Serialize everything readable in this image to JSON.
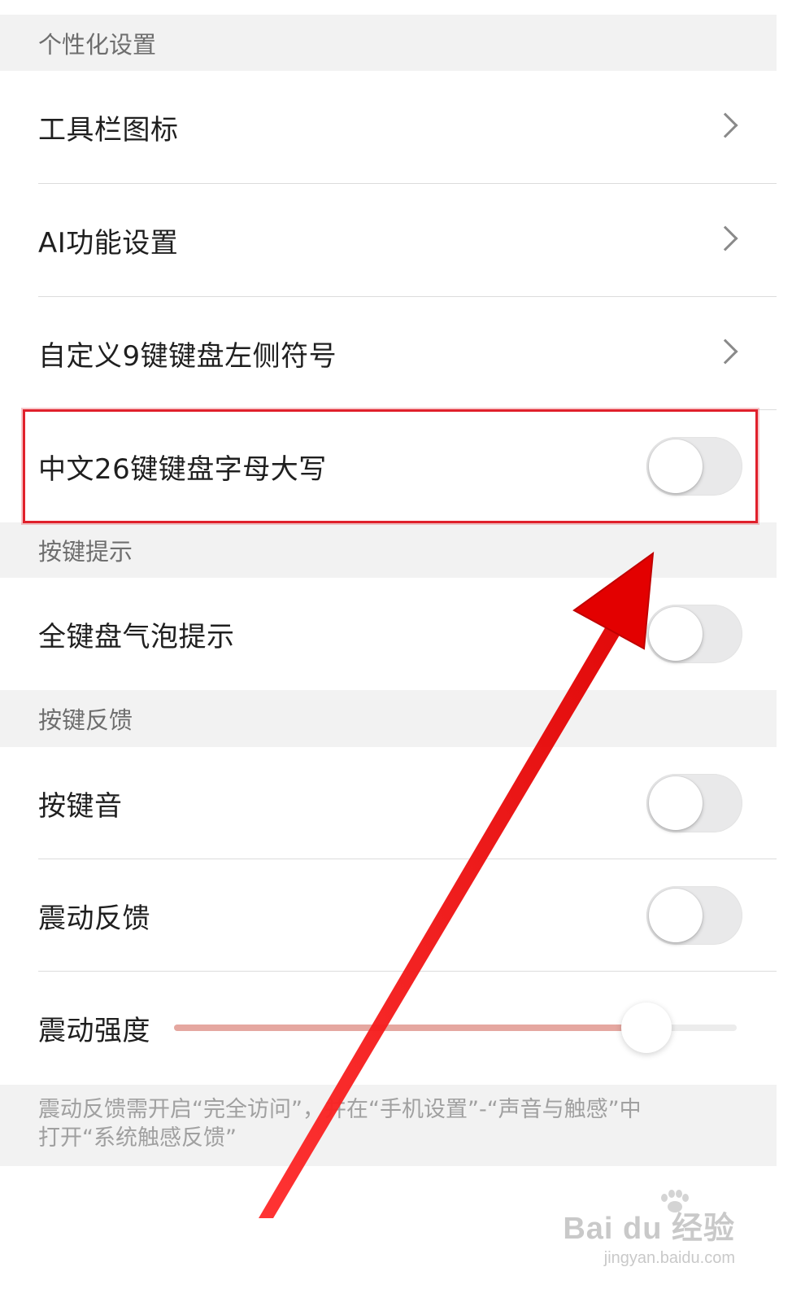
{
  "sections": {
    "personalization": "个性化设置",
    "key_hint": "按键提示",
    "key_feedback": "按键反馈"
  },
  "rows": {
    "toolbar_icons": "工具栏图标",
    "ai_settings": "AI功能设置",
    "custom_9key_symbols": "自定义9键键盘左侧符号",
    "chinese_26key_uppercase": "中文26键键盘字母大写",
    "full_keyboard_bubble": "全键盘气泡提示",
    "key_sound": "按键音",
    "vibration_feedback": "震动反馈",
    "vibration_strength": "震动强度"
  },
  "toggles": {
    "chinese_26key_uppercase": false,
    "full_keyboard_bubble": false,
    "key_sound": false,
    "vibration_feedback": false
  },
  "slider": {
    "vibration_strength_fraction": 0.84
  },
  "footer": {
    "line1": "震动反馈需开启“完全访问”，并在“手机设置”-“声音与触感”中",
    "line2": "打开“系统触感反馈”"
  },
  "watermark": {
    "main": "Bai du 经验",
    "sub": "jingyan.baidu.com"
  },
  "colors": {
    "annotation_red": "#e0202b",
    "slider_fill": "#e5a7a0",
    "section_bg": "#f2f2f2"
  }
}
